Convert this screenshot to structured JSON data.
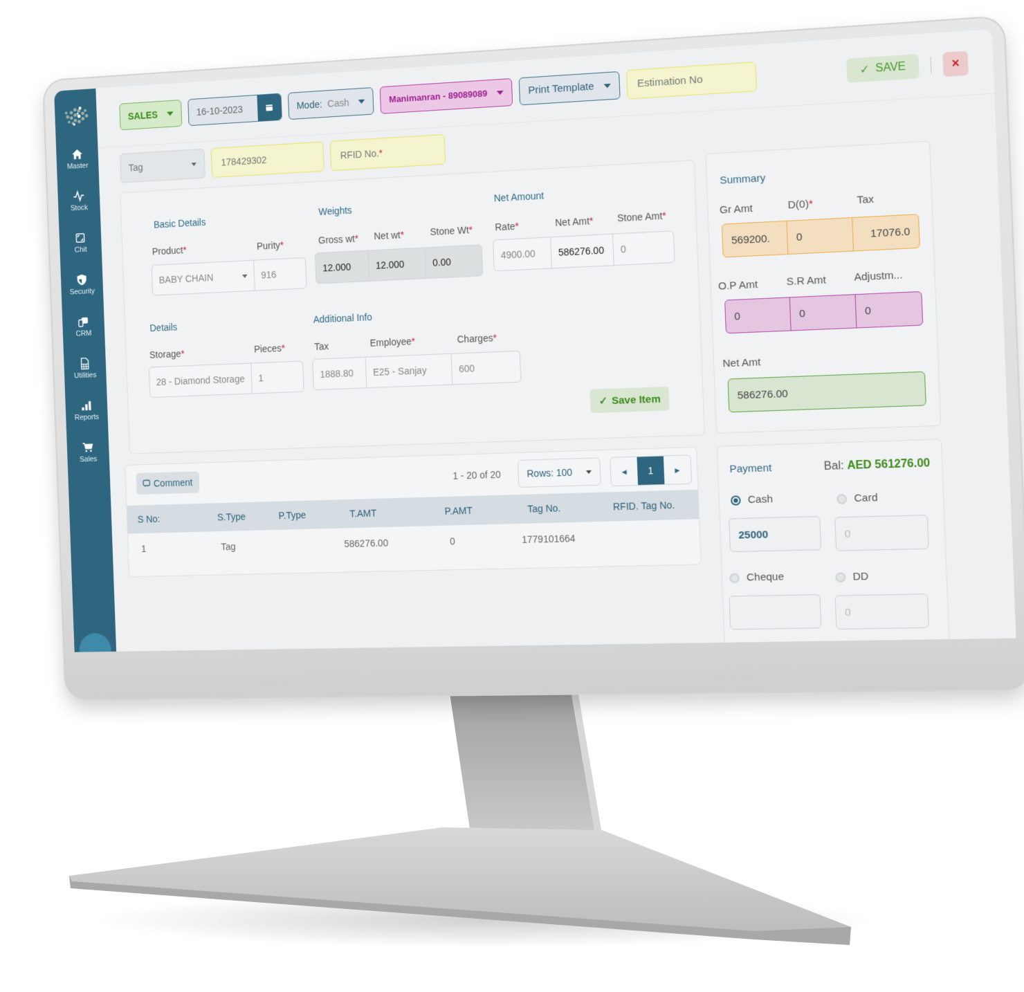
{
  "sidebar": {
    "items": [
      {
        "label": "Master",
        "icon": "home-icon"
      },
      {
        "label": "Stock",
        "icon": "pulse-icon"
      },
      {
        "label": "Chit",
        "icon": "chit-icon"
      },
      {
        "label": "Security",
        "icon": "shield-icon"
      },
      {
        "label": "CRM",
        "icon": "crm-icon"
      },
      {
        "label": "Utilities",
        "icon": "document-grid-icon"
      },
      {
        "label": "Reports",
        "icon": "bar-chart-icon"
      },
      {
        "label": "Sales",
        "icon": "cart-icon"
      }
    ]
  },
  "topbar": {
    "transaction_type": "SALES",
    "date": "16-10-2023",
    "mode_label": "Mode:",
    "mode_value": "Cash",
    "customer": "Manimanran - 89089089",
    "print_template": "Print Template",
    "estimation_placeholder": "Estimation No",
    "save_label": "SAVE",
    "close_label": "×"
  },
  "tag_row": {
    "tag_type": "Tag",
    "tag_number": "178429302",
    "rfid_placeholder": "RFID No."
  },
  "item": {
    "basic_details_title": "Basic Details",
    "product_label": "Product",
    "purity_label": "Purity",
    "product_value": "BABY CHAIN",
    "purity_value": "916",
    "weights_title": "Weights",
    "gross_wt_label": "Gross wt",
    "net_wt_label": "Net wt",
    "stone_wt_label": "Stone Wt",
    "gross_wt": "12.000",
    "net_wt": "12.000",
    "stone_wt": "0.00",
    "net_amount_title": "Net Amount",
    "rate_label": "Rate",
    "net_amt_label": "Net Amt",
    "stone_amt_label": "Stone Amt",
    "rate": "4900.00",
    "net_amt": "586276.00",
    "stone_amt": "0",
    "details_title": "Details",
    "storage_label": "Storage",
    "pieces_label": "Pieces",
    "storage": "28 - Diamond Storage",
    "pieces": "1",
    "additional_title": "Additional Info",
    "tax_label": "Tax",
    "employee_label": "Employee",
    "charges_label": "Charges",
    "tax": "1888.80",
    "employee": "E25 - Sanjay",
    "charges": "600",
    "save_item_label": "Save Item"
  },
  "summary": {
    "title": "Summary",
    "gr_amt_label": "Gr Amt",
    "discount_label": "D(0)",
    "tax_label": "Tax",
    "gr_amt": "569200.",
    "discount": "0",
    "tax": "17076.0",
    "op_amt_label": "O.P Amt",
    "sr_amt_label": "S.R Amt",
    "adjustment_label": "Adjustm...",
    "op_amt": "0",
    "sr_amt": "0",
    "adjustment": "0",
    "net_amt_label": "Net Amt",
    "net_amt": "586276.00"
  },
  "table": {
    "comment_label": "Comment",
    "pager_info": "1 - 20 of 20",
    "rows_label": "Rows: 100",
    "current_page": "1",
    "columns": [
      "S No:",
      "S.Type",
      "P.Type",
      "T.AMT",
      "P.AMT",
      "Tag No.",
      "RFID. Tag No."
    ],
    "rows": [
      [
        "1",
        "Tag",
        "",
        "586276.00",
        "0",
        "1779101664",
        ""
      ]
    ]
  },
  "payment": {
    "title": "Payment",
    "balance_label": "Bal:",
    "balance_value": "AED 561276.00",
    "cash_label": "Cash",
    "card_label": "Card",
    "cheque_label": "Cheque",
    "dd_label": "DD",
    "cash_value": "25000",
    "card_placeholder": "0",
    "cheque_placeholder": "",
    "dd_placeholder": "0",
    "selected": "Cash"
  },
  "colors": {
    "sidebar": "#2e6680",
    "accent_green": "#3c8a19",
    "accent_purple": "#9c1f8e",
    "accent_orange": "#ecac4c",
    "required": "#c2213a"
  }
}
